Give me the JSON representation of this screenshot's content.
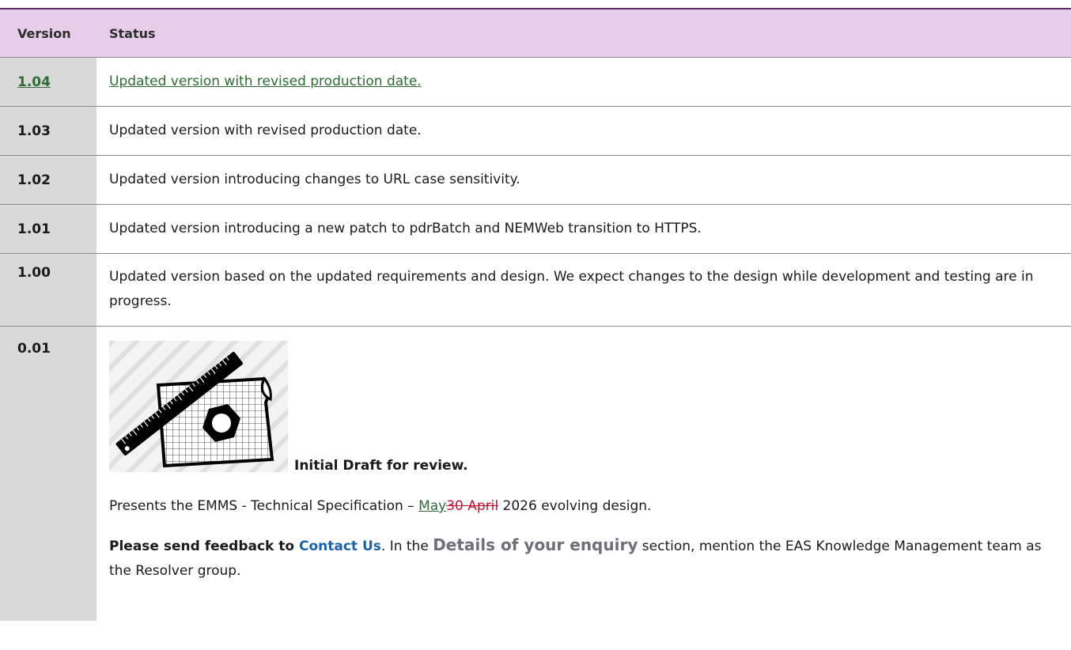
{
  "header": {
    "version": "Version",
    "status": "Status"
  },
  "rows": [
    {
      "version": "1.04",
      "status": "Updated version with revised production date."
    },
    {
      "version": "1.03",
      "status": "Updated version with revised production date."
    },
    {
      "version": "1.02",
      "status": "Updated version introducing changes to URL case sensitivity."
    },
    {
      "version": "1.01",
      "status": "Updated version introducing a new patch to pdrBatch and NEMWeb transition to HTTPS."
    },
    {
      "version": "1.00",
      "status": "Updated version based on the updated requirements and design. We expect changes to the design while development and testing are in progress."
    }
  ],
  "draft": {
    "version": "0.01",
    "image_icon": "ruler-blueprint-nut-icon",
    "title": "Initial Draft for review.",
    "spec_prefix": "Presents the EMMS - Technical Specification – ",
    "spec_inserted": "May",
    "spec_deleted": "30 April",
    "spec_suffix": " 2026 evolving design.",
    "feedback_prefix": "Please send feedback to ",
    "contact_link": "Contact Us",
    "feedback_mid": ". In the ",
    "details_label": "Details of your enquiry",
    "feedback_suffix": " section, mention the EAS Knowledge Management team as the Resolver group."
  },
  "colors": {
    "header_bg": "#e6cde8",
    "header_border": "#5b2d6e",
    "version_column_bg": "#d9d9d9",
    "inserted_text": "#2e6b33",
    "deleted_text": "#c0162f",
    "link_blue": "#1a62ad",
    "details_grey": "#6f6f77"
  }
}
